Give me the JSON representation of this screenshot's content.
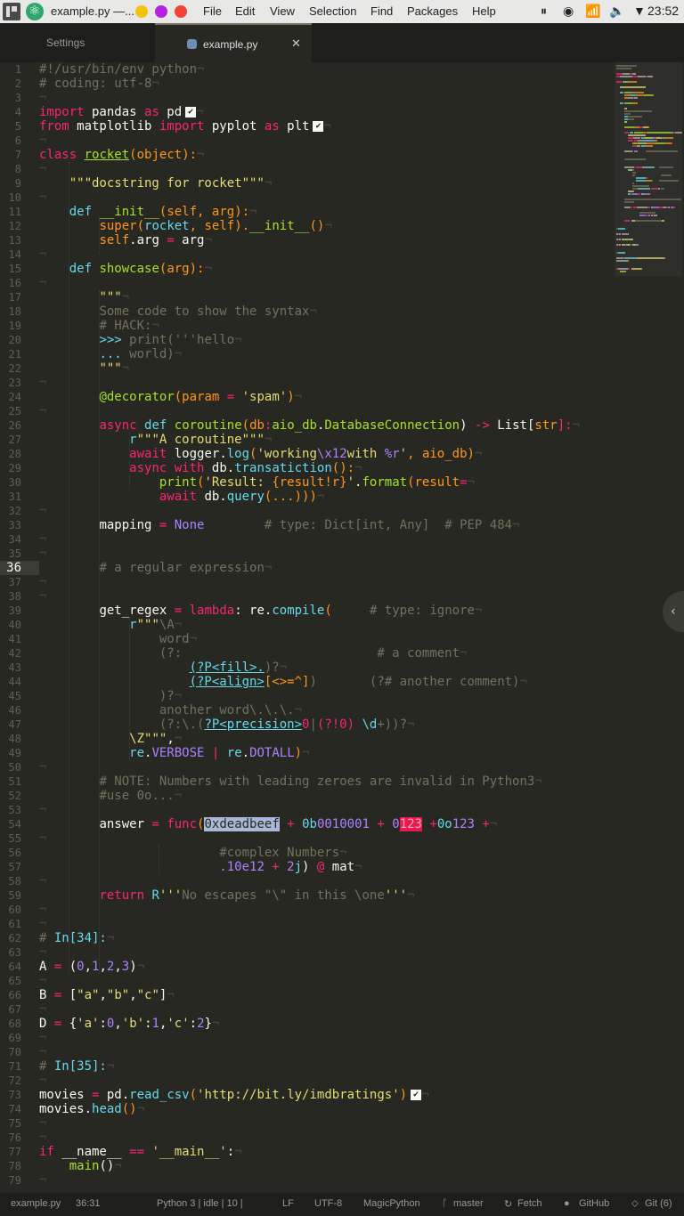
{
  "topbar": {
    "app_title": "example.py —...",
    "menu": [
      "File",
      "Edit",
      "View",
      "Selection",
      "Find",
      "Packages",
      "Help"
    ],
    "clock": "23:52",
    "window_dots": [
      "#f4c20d",
      "#b620e0",
      "#f44336"
    ]
  },
  "tabs": [
    {
      "label": "Settings",
      "active": false
    },
    {
      "label": "example.py",
      "active": true,
      "icon": "python-file-icon"
    }
  ],
  "editor": {
    "current_line": 36,
    "lines": [
      [
        [
          "#!/usr/bin/env python",
          "c"
        ]
      ],
      [
        [
          "# coding: utf-8",
          "c"
        ]
      ],
      [],
      [
        [
          "import",
          "k"
        ],
        [
          " pandas "
        ],
        [
          "as",
          "k"
        ],
        [
          " pd"
        ],
        [
          "✔",
          "check"
        ]
      ],
      [
        [
          "from",
          "k"
        ],
        [
          " matplotlib "
        ],
        [
          "import",
          "k"
        ],
        [
          " pyplot "
        ],
        [
          "as",
          "k"
        ],
        [
          " plt"
        ],
        [
          "✔",
          "check"
        ]
      ],
      [],
      [
        [
          "class",
          "k"
        ],
        [
          " "
        ],
        [
          "rocket",
          "f u"
        ],
        [
          "(",
          "o"
        ],
        [
          "object",
          "o"
        ],
        [
          "):",
          "o"
        ]
      ],
      [],
      [
        [
          "    "
        ],
        [
          "\"\"\"docstring for rocket\"\"\"",
          "s"
        ]
      ],
      [],
      [
        [
          "    "
        ],
        [
          "def",
          "b"
        ],
        [
          " "
        ],
        [
          "__init__",
          "f"
        ],
        [
          "(",
          "o"
        ],
        [
          "self, arg",
          "o"
        ],
        [
          "):",
          "o"
        ]
      ],
      [
        [
          "        "
        ],
        [
          "super",
          "o"
        ],
        [
          "(",
          "o"
        ],
        [
          "rocket",
          "b"
        ],
        [
          ", ",
          "o"
        ],
        [
          "self",
          "o"
        ],
        [
          ").",
          "o"
        ],
        [
          "__init__",
          "f"
        ],
        [
          "()",
          "o"
        ]
      ],
      [
        [
          "        "
        ],
        [
          "self",
          "o"
        ],
        [
          ".arg "
        ],
        [
          "=",
          "k"
        ],
        [
          " arg"
        ]
      ],
      [],
      [
        [
          "    "
        ],
        [
          "def",
          "b"
        ],
        [
          " "
        ],
        [
          "showcase",
          "f"
        ],
        [
          "(arg):",
          "o"
        ]
      ],
      [],
      [
        [
          "        "
        ],
        [
          "\"\"\"",
          "s"
        ]
      ],
      [
        [
          "        "
        ],
        [
          "Some code to show the syntax",
          "c"
        ]
      ],
      [
        [
          "        "
        ],
        [
          "# HACK:",
          "c"
        ]
      ],
      [
        [
          "        "
        ],
        [
          ">>> ",
          "b"
        ],
        [
          "print('''hello",
          "c"
        ]
      ],
      [
        [
          "        "
        ],
        [
          "... ",
          "b"
        ],
        [
          "world)",
          "c"
        ]
      ],
      [
        [
          "        "
        ],
        [
          "\"\"\"",
          "s"
        ]
      ],
      [],
      [
        [
          "        "
        ],
        [
          "@decorator",
          "f"
        ],
        [
          "(",
          "o"
        ],
        [
          "param",
          "o"
        ],
        [
          " = ",
          "k"
        ],
        [
          "'spam'",
          "s"
        ],
        [
          ")",
          "o"
        ]
      ],
      [],
      [
        [
          "        "
        ],
        [
          "async",
          "k"
        ],
        [
          " "
        ],
        [
          "def",
          "b"
        ],
        [
          " "
        ],
        [
          "coroutine",
          "f"
        ],
        [
          "(",
          "o"
        ],
        [
          "db",
          "o"
        ],
        [
          ":",
          "k"
        ],
        [
          "aio_db",
          "f"
        ],
        [
          "."
        ],
        [
          "DatabaseConnection",
          "f"
        ],
        [
          ") "
        ],
        [
          "->",
          "k"
        ],
        [
          " List["
        ],
        [
          "str",
          "o"
        ],
        [
          "]:",
          "k"
        ]
      ],
      [
        [
          "            "
        ],
        [
          "r",
          "b"
        ],
        [
          "\"\"\"A coroutine\"\"\"",
          "s"
        ]
      ],
      [
        [
          "            "
        ],
        [
          "await",
          "k"
        ],
        [
          " logger."
        ],
        [
          "log",
          "b"
        ],
        [
          "(",
          "o"
        ],
        [
          "'working",
          "s"
        ],
        [
          "\\x12",
          "n"
        ],
        [
          "with ",
          "s"
        ],
        [
          "%r",
          "n"
        ],
        [
          "'",
          "s"
        ],
        [
          ", aio_db",
          "o"
        ],
        [
          ")",
          "o"
        ]
      ],
      [
        [
          "            "
        ],
        [
          "async",
          "k"
        ],
        [
          " "
        ],
        [
          "with",
          "k"
        ],
        [
          " db."
        ],
        [
          "transatiction",
          "b"
        ],
        [
          "():",
          "o"
        ]
      ],
      [
        [
          "                "
        ],
        [
          "print",
          "f"
        ],
        [
          "(",
          "o"
        ],
        [
          "'Result: ",
          "s"
        ],
        [
          "{result!r}",
          "o"
        ],
        [
          "'",
          "s"
        ],
        [
          "."
        ],
        [
          "format",
          "f"
        ],
        [
          "(result",
          "o"
        ],
        [
          "=",
          "k"
        ]
      ],
      [
        [
          "                "
        ],
        [
          "await",
          "k"
        ],
        [
          " db."
        ],
        [
          "query",
          "b"
        ],
        [
          "(...)))",
          "o"
        ]
      ],
      [],
      [
        [
          "        "
        ],
        [
          "mapping "
        ],
        [
          "=",
          "k"
        ],
        [
          " "
        ],
        [
          "None",
          "n"
        ],
        [
          "        "
        ],
        [
          "# type: ",
          "c"
        ],
        [
          "Dict",
          "c"
        ],
        [
          "[int, Any]",
          "c"
        ],
        [
          "  # PEP 484",
          "c"
        ]
      ],
      [],
      [],
      [
        [
          "        "
        ],
        [
          "# a regular expression",
          "c"
        ]
      ],
      [],
      [],
      [
        [
          "        "
        ],
        [
          "get_regex "
        ],
        [
          "=",
          "k"
        ],
        [
          " "
        ],
        [
          "lambda",
          "k"
        ],
        [
          ": re."
        ],
        [
          "compile",
          "b"
        ],
        [
          "(",
          "o"
        ],
        [
          "     "
        ],
        [
          "# type: ignore",
          "c"
        ]
      ],
      [
        [
          "            "
        ],
        [
          "r",
          "b"
        ],
        [
          "\"\"\"",
          "s"
        ],
        [
          "\\A",
          "c"
        ]
      ],
      [
        [
          "                "
        ],
        [
          "word",
          "c"
        ]
      ],
      [
        [
          "                "
        ],
        [
          "(?:",
          "c"
        ],
        [
          "                          "
        ],
        [
          "# a comment",
          "c"
        ]
      ],
      [
        [
          "                    "
        ],
        [
          "(?P<fill>.",
          "b u"
        ],
        [
          ")?",
          "c"
        ]
      ],
      [
        [
          "                    "
        ],
        [
          "(?P<align>",
          "b u"
        ],
        [
          "[<>=^]",
          "o"
        ],
        [
          ")",
          "c"
        ],
        [
          "       "
        ],
        [
          "(?# another comment)",
          "c"
        ]
      ],
      [
        [
          "                "
        ],
        [
          ")?",
          "c"
        ]
      ],
      [
        [
          "                "
        ],
        [
          "another word\\.\\.\\.",
          "c"
        ]
      ],
      [
        [
          "                "
        ],
        [
          "(?:\\.(",
          "c"
        ],
        [
          "?P<precision>",
          "b u"
        ],
        [
          "0",
          "k"
        ],
        [
          "|",
          "c"
        ],
        [
          "(?!0) ",
          "k"
        ],
        [
          "\\d",
          "b"
        ],
        [
          "+))?",
          "c"
        ]
      ],
      [
        [
          "            "
        ],
        [
          "\\Z\"\"\"",
          "s"
        ],
        [
          ","
        ]
      ],
      [
        [
          "            "
        ],
        [
          "re",
          "b"
        ],
        [
          "."
        ],
        [
          "VERBOSE",
          "n"
        ],
        [
          " | ",
          "k"
        ],
        [
          "re",
          "b"
        ],
        [
          "."
        ],
        [
          "DOTALL",
          "n"
        ],
        [
          ")",
          "o"
        ]
      ],
      [],
      [
        [
          "        "
        ],
        [
          "# NOTE",
          "c"
        ],
        [
          ": Numbers with leading zeroes are invalid in Python3",
          "c"
        ]
      ],
      [
        [
          "        "
        ],
        [
          "#use 0o...",
          "c"
        ]
      ],
      [],
      [
        [
          "        "
        ],
        [
          "answer "
        ],
        [
          "=",
          "k"
        ],
        [
          " "
        ],
        [
          "func",
          "k"
        ],
        [
          "(",
          "o"
        ],
        [
          "0xdeadbeef",
          "hl"
        ],
        [
          " + ",
          "k"
        ],
        [
          "0b",
          "b"
        ],
        [
          "0010001",
          "n"
        ],
        [
          " + ",
          "k"
        ],
        [
          "0",
          "n"
        ],
        [
          "123",
          "err2"
        ],
        [
          " +",
          "k"
        ],
        [
          "0o",
          "b"
        ],
        [
          "123",
          "n"
        ],
        [
          " +",
          "k"
        ]
      ],
      [],
      [
        [
          "                        "
        ],
        [
          "#complex Numbers",
          "c"
        ]
      ],
      [
        [
          "                        "
        ],
        [
          ".10e12",
          "n"
        ],
        [
          " + ",
          "k"
        ],
        [
          "2",
          "n"
        ],
        [
          "j",
          "b"
        ],
        [
          ") "
        ],
        [
          "@",
          "k"
        ],
        [
          " mat"
        ]
      ],
      [],
      [
        [
          "        "
        ],
        [
          "return",
          "k"
        ],
        [
          " "
        ],
        [
          "R",
          "b"
        ],
        [
          "'''",
          "s"
        ],
        [
          "No escapes \"\\\" in this \\one",
          "c"
        ],
        [
          "'''",
          "s"
        ]
      ],
      [],
      [],
      [
        [
          "# ",
          "c"
        ],
        [
          "In[34]:",
          "b"
        ]
      ],
      [],
      [
        [
          "A "
        ],
        [
          "=",
          "k"
        ],
        [
          " ("
        ],
        [
          "0",
          "n"
        ],
        [
          ","
        ],
        [
          "1",
          "n"
        ],
        [
          ","
        ],
        [
          "2",
          "n"
        ],
        [
          ","
        ],
        [
          "3",
          "n"
        ],
        [
          ")"
        ]
      ],
      [],
      [
        [
          "B "
        ],
        [
          "=",
          "k"
        ],
        [
          " ["
        ],
        [
          "\"a\"",
          "s"
        ],
        [
          ","
        ],
        [
          "\"b\"",
          "s"
        ],
        [
          ","
        ],
        [
          "\"c\"",
          "s"
        ],
        [
          "]"
        ]
      ],
      [],
      [
        [
          "D "
        ],
        [
          "=",
          "k"
        ],
        [
          " {"
        ],
        [
          "'a'",
          "s"
        ],
        [
          ":"
        ],
        [
          "0",
          "n"
        ],
        [
          ","
        ],
        [
          "'b'",
          "s"
        ],
        [
          ":"
        ],
        [
          "1",
          "n"
        ],
        [
          ","
        ],
        [
          "'c'",
          "s"
        ],
        [
          ":"
        ],
        [
          "2",
          "n"
        ],
        [
          "}"
        ]
      ],
      [],
      [],
      [
        [
          "# ",
          "c"
        ],
        [
          "In[35]:",
          "b"
        ]
      ],
      [],
      [
        [
          "movies "
        ],
        [
          "=",
          "k"
        ],
        [
          " pd."
        ],
        [
          "read_csv",
          "b"
        ],
        [
          "(",
          "o"
        ],
        [
          "'http://bit.ly/imdbratings'",
          "s"
        ],
        [
          ")",
          "o"
        ],
        [
          "✔",
          "check"
        ]
      ],
      [
        [
          "movies."
        ],
        [
          "head",
          "b"
        ],
        [
          "()",
          "o"
        ]
      ],
      [],
      [],
      [
        [
          "if",
          "k"
        ],
        [
          " __name__ "
        ],
        [
          "==",
          "k"
        ],
        [
          " "
        ],
        [
          "'__main__'",
          "s"
        ],
        [
          ":"
        ]
      ],
      [
        [
          "    "
        ],
        [
          "main",
          "f"
        ],
        [
          "()"
        ]
      ],
      []
    ]
  },
  "statusbar": {
    "file": "example.py",
    "cursor": "36:31",
    "kernel": "Python 3 | idle | 10 |",
    "line_ending": "LF",
    "encoding": "UTF-8",
    "grammar": "MagicPython",
    "branch": "master",
    "fetch": "Fetch",
    "github": "GitHub",
    "git": "Git (6)"
  }
}
